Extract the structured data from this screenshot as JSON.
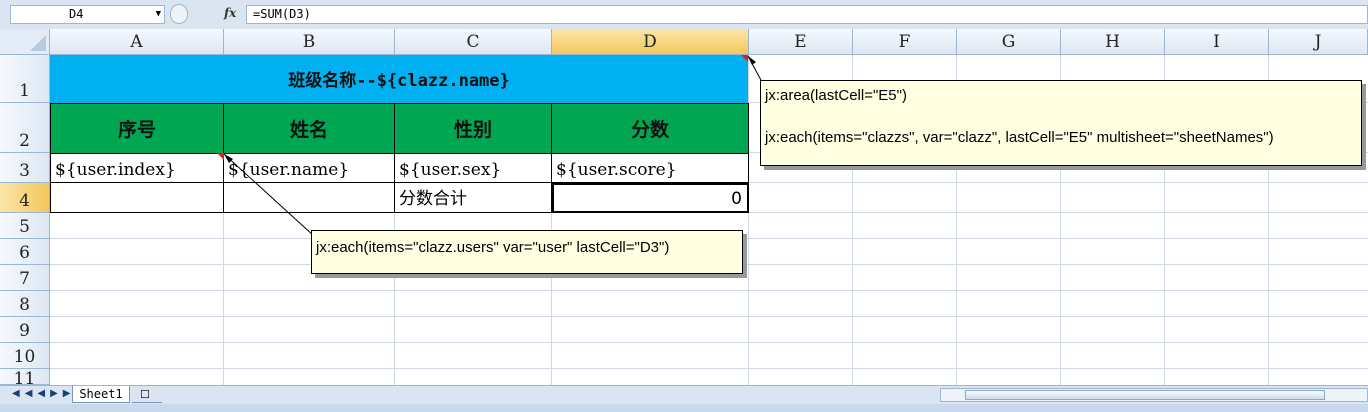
{
  "formula_bar": {
    "name_box": "D4",
    "fx_icon": "fx-icon",
    "formula": "=SUM(D3)"
  },
  "columns": [
    "A",
    "B",
    "C",
    "D",
    "E",
    "F",
    "G",
    "H",
    "I",
    "J"
  ],
  "rows": [
    "1",
    "2",
    "3",
    "4",
    "5",
    "6",
    "7",
    "8",
    "9",
    "10",
    "11"
  ],
  "selected": {
    "column": "D",
    "row": "4"
  },
  "sheet": {
    "title": "班级名称--${clazz.name}",
    "headers": [
      "序号",
      "姓名",
      "性别",
      "分数"
    ],
    "row3": [
      "${user.index}",
      "${user.name}",
      "${user.sex}",
      "${user.score}"
    ],
    "row4": {
      "c_label": "分数合计",
      "d_value": "0"
    }
  },
  "comments": {
    "area_line1": "jx:area(lastCell=\"E5\")",
    "area_line2": "jx:each(items=\"clazzs\", var=\"clazz\", lastCell=\"E5\" multisheet=\"sheetNames\")",
    "each_users": "jx:each(items=\"clazz.users\" var=\"user\" lastCell=\"D3\")"
  },
  "tabs": {
    "sheet1": "Sheet1"
  },
  "colors": {
    "title_fill": "#00b0f0",
    "header_fill": "#00a651",
    "comment_fill": "#ffffe1",
    "indicator": "#e02020"
  }
}
